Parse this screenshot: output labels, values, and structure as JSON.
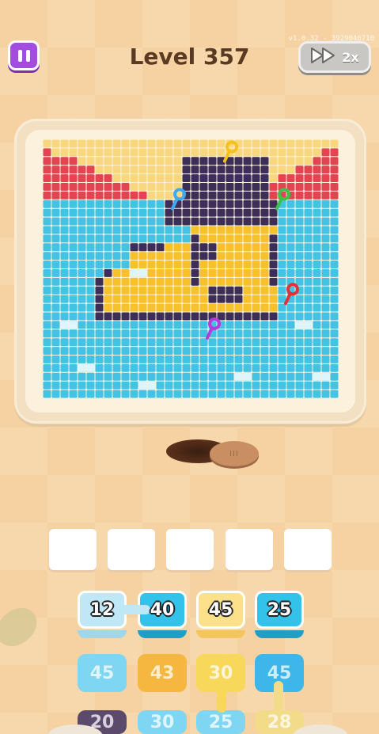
{
  "header": {
    "level_title": "Level 357",
    "version": "v1.0.32 - 3929046710",
    "speed_label": "2x",
    "pause_icon": "pause-icon",
    "speed_icon": "fast-forward-icon"
  },
  "colors": {
    "sky": "#f9d77e",
    "red": "#e24452",
    "water": "#43c3e3",
    "hat": "#3d2e57",
    "duck": "#f6c12b",
    "white": "#ffffff",
    "pause": "#a34de0"
  },
  "keys": [
    {
      "color": "#f4c21b",
      "name": "yellow-key-icon"
    },
    {
      "color": "#40a9f0",
      "name": "blue-key-icon"
    },
    {
      "color": "#3cc24c",
      "name": "green-key-icon"
    },
    {
      "color": "#e0323a",
      "name": "red-key-icon"
    },
    {
      "color": "#b63adc",
      "name": "purple-key-icon"
    }
  ],
  "slots": [
    "",
    "",
    "",
    "",
    ""
  ],
  "tiles": {
    "row1": [
      {
        "value": "12",
        "color": "#bfe7f5"
      },
      {
        "value": "40",
        "color": "#32c2ea"
      },
      {
        "value": "45",
        "color": "#fde08a"
      },
      {
        "value": "25",
        "color": "#32c2ea"
      }
    ],
    "row2": [
      {
        "value": "45",
        "color": "#7fd6f2"
      },
      {
        "value": "43",
        "color": "#f6b740"
      },
      {
        "value": "30",
        "color": "#f8d85a"
      },
      {
        "value": "45",
        "color": "#3fb6ea"
      }
    ],
    "row3": [
      {
        "value": "20",
        "color": "#5b4a6c"
      },
      {
        "value": "30",
        "color": "#7fd6f2"
      },
      {
        "value": "25",
        "color": "#7fd6f2"
      },
      {
        "value": "28",
        "color": "#f2dc8a"
      }
    ]
  }
}
